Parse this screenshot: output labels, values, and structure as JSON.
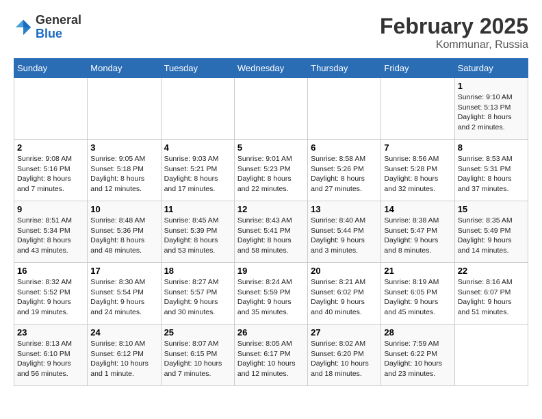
{
  "header": {
    "logo_general": "General",
    "logo_blue": "Blue",
    "title": "February 2025",
    "subtitle": "Kommunar, Russia"
  },
  "days_of_week": [
    "Sunday",
    "Monday",
    "Tuesday",
    "Wednesday",
    "Thursday",
    "Friday",
    "Saturday"
  ],
  "weeks": [
    [
      {
        "day": "",
        "info": ""
      },
      {
        "day": "",
        "info": ""
      },
      {
        "day": "",
        "info": ""
      },
      {
        "day": "",
        "info": ""
      },
      {
        "day": "",
        "info": ""
      },
      {
        "day": "",
        "info": ""
      },
      {
        "day": "1",
        "info": "Sunrise: 9:10 AM\nSunset: 5:13 PM\nDaylight: 8 hours and 2 minutes."
      }
    ],
    [
      {
        "day": "2",
        "info": "Sunrise: 9:08 AM\nSunset: 5:16 PM\nDaylight: 8 hours and 7 minutes."
      },
      {
        "day": "3",
        "info": "Sunrise: 9:05 AM\nSunset: 5:18 PM\nDaylight: 8 hours and 12 minutes."
      },
      {
        "day": "4",
        "info": "Sunrise: 9:03 AM\nSunset: 5:21 PM\nDaylight: 8 hours and 17 minutes."
      },
      {
        "day": "5",
        "info": "Sunrise: 9:01 AM\nSunset: 5:23 PM\nDaylight: 8 hours and 22 minutes."
      },
      {
        "day": "6",
        "info": "Sunrise: 8:58 AM\nSunset: 5:26 PM\nDaylight: 8 hours and 27 minutes."
      },
      {
        "day": "7",
        "info": "Sunrise: 8:56 AM\nSunset: 5:28 PM\nDaylight: 8 hours and 32 minutes."
      },
      {
        "day": "8",
        "info": "Sunrise: 8:53 AM\nSunset: 5:31 PM\nDaylight: 8 hours and 37 minutes."
      }
    ],
    [
      {
        "day": "9",
        "info": "Sunrise: 8:51 AM\nSunset: 5:34 PM\nDaylight: 8 hours and 43 minutes."
      },
      {
        "day": "10",
        "info": "Sunrise: 8:48 AM\nSunset: 5:36 PM\nDaylight: 8 hours and 48 minutes."
      },
      {
        "day": "11",
        "info": "Sunrise: 8:45 AM\nSunset: 5:39 PM\nDaylight: 8 hours and 53 minutes."
      },
      {
        "day": "12",
        "info": "Sunrise: 8:43 AM\nSunset: 5:41 PM\nDaylight: 8 hours and 58 minutes."
      },
      {
        "day": "13",
        "info": "Sunrise: 8:40 AM\nSunset: 5:44 PM\nDaylight: 9 hours and 3 minutes."
      },
      {
        "day": "14",
        "info": "Sunrise: 8:38 AM\nSunset: 5:47 PM\nDaylight: 9 hours and 8 minutes."
      },
      {
        "day": "15",
        "info": "Sunrise: 8:35 AM\nSunset: 5:49 PM\nDaylight: 9 hours and 14 minutes."
      }
    ],
    [
      {
        "day": "16",
        "info": "Sunrise: 8:32 AM\nSunset: 5:52 PM\nDaylight: 9 hours and 19 minutes."
      },
      {
        "day": "17",
        "info": "Sunrise: 8:30 AM\nSunset: 5:54 PM\nDaylight: 9 hours and 24 minutes."
      },
      {
        "day": "18",
        "info": "Sunrise: 8:27 AM\nSunset: 5:57 PM\nDaylight: 9 hours and 30 minutes."
      },
      {
        "day": "19",
        "info": "Sunrise: 8:24 AM\nSunset: 5:59 PM\nDaylight: 9 hours and 35 minutes."
      },
      {
        "day": "20",
        "info": "Sunrise: 8:21 AM\nSunset: 6:02 PM\nDaylight: 9 hours and 40 minutes."
      },
      {
        "day": "21",
        "info": "Sunrise: 8:19 AM\nSunset: 6:05 PM\nDaylight: 9 hours and 45 minutes."
      },
      {
        "day": "22",
        "info": "Sunrise: 8:16 AM\nSunset: 6:07 PM\nDaylight: 9 hours and 51 minutes."
      }
    ],
    [
      {
        "day": "23",
        "info": "Sunrise: 8:13 AM\nSunset: 6:10 PM\nDaylight: 9 hours and 56 minutes."
      },
      {
        "day": "24",
        "info": "Sunrise: 8:10 AM\nSunset: 6:12 PM\nDaylight: 10 hours and 1 minute."
      },
      {
        "day": "25",
        "info": "Sunrise: 8:07 AM\nSunset: 6:15 PM\nDaylight: 10 hours and 7 minutes."
      },
      {
        "day": "26",
        "info": "Sunrise: 8:05 AM\nSunset: 6:17 PM\nDaylight: 10 hours and 12 minutes."
      },
      {
        "day": "27",
        "info": "Sunrise: 8:02 AM\nSunset: 6:20 PM\nDaylight: 10 hours and 18 minutes."
      },
      {
        "day": "28",
        "info": "Sunrise: 7:59 AM\nSunset: 6:22 PM\nDaylight: 10 hours and 23 minutes."
      },
      {
        "day": "",
        "info": ""
      }
    ]
  ]
}
